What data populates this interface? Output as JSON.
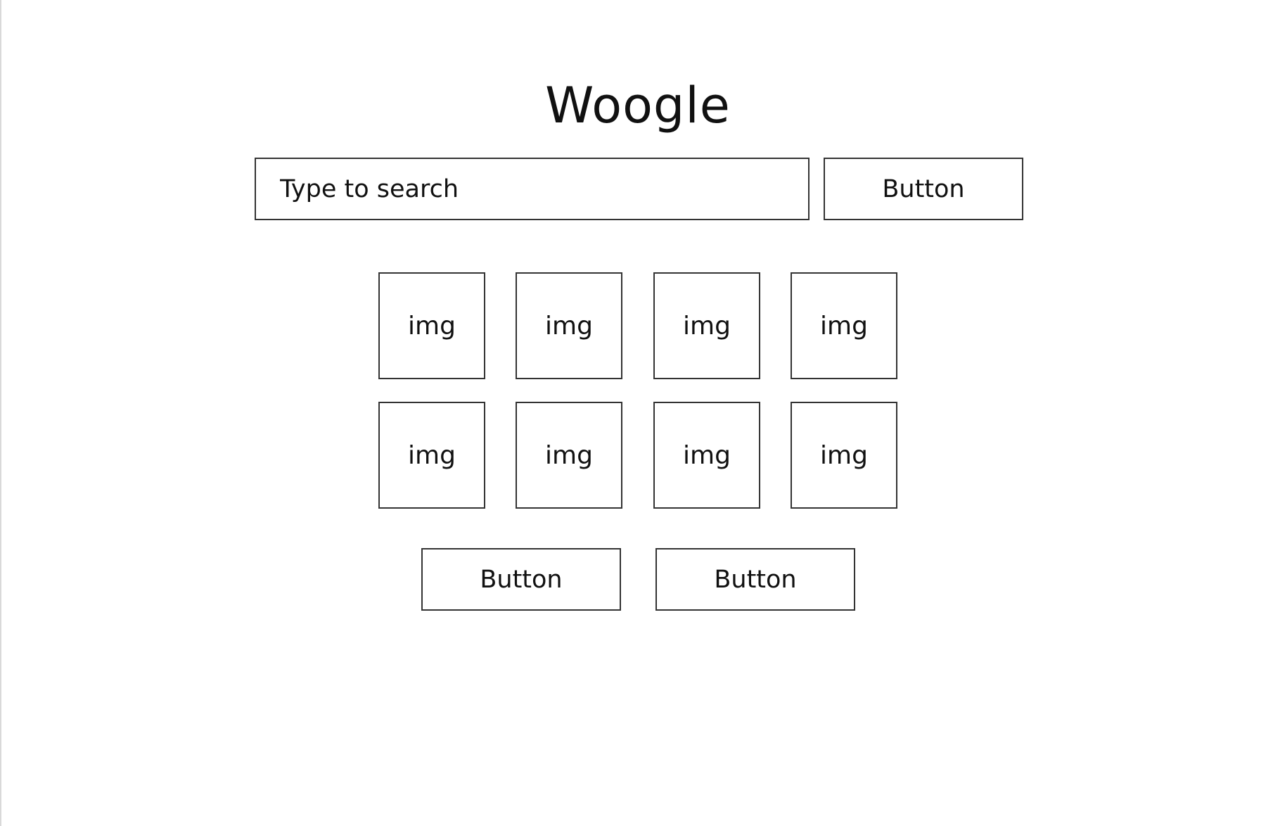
{
  "header": {
    "title": "Woogle"
  },
  "search": {
    "placeholder": "Type to search",
    "value": "",
    "button_label": "Button"
  },
  "grid": {
    "tiles": [
      "img",
      "img",
      "img",
      "img",
      "img",
      "img",
      "img",
      "img"
    ]
  },
  "footer_buttons": {
    "first_label": "Button",
    "second_label": "Button"
  },
  "colors": {
    "border": "#333333",
    "text": "#111111",
    "background": "#ffffff"
  }
}
